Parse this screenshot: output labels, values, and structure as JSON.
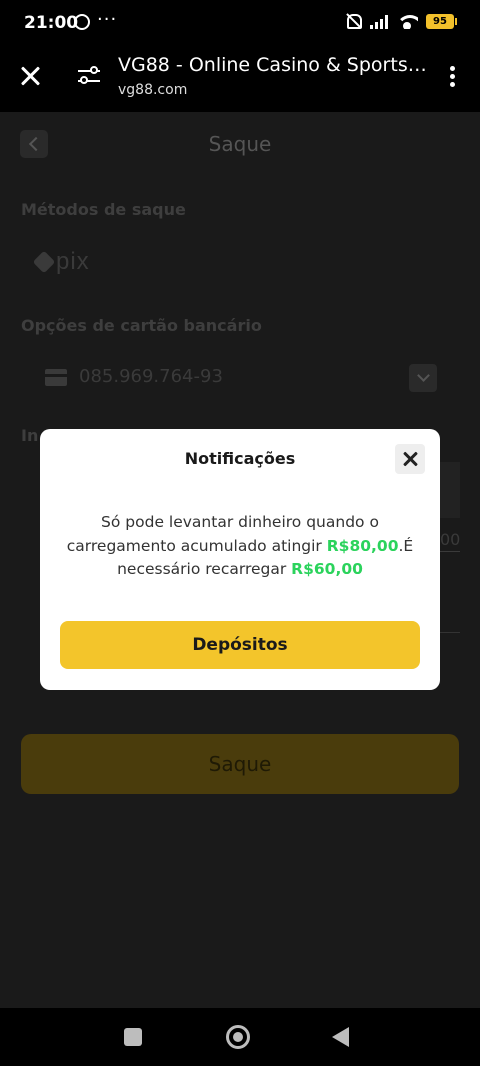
{
  "status_bar": {
    "time": "21:00",
    "notification_more": "···",
    "battery": "95",
    "icons": [
      "whatsapp-icon",
      "muted-bell-icon",
      "signal-icon",
      "wifi-icon",
      "battery-icon"
    ]
  },
  "browser": {
    "title": "VG88 - Online Casino & Sports Be...",
    "url": "vg88.com"
  },
  "page": {
    "title": "Saque",
    "withdraw_methods_label": "Métodos de saque",
    "pix_label": "pix",
    "bank_card_label": "Opções de cartão bancário",
    "card_number": "085.969.764-93",
    "partial_label": "In",
    "partial_amount": "00",
    "submit_label": "Saque"
  },
  "modal": {
    "title": "Notificações",
    "message_part1": "Só pode levantar dinheiro quando o carregamento acumulado atingir ",
    "required_amount": "R$80,00",
    "message_part2": ".É necessário recarregar ",
    "remaining_amount": "R$60,00",
    "button_label": "Depósitos"
  },
  "colors": {
    "accent": "#f3c52b",
    "highlight": "#2bd35c"
  }
}
